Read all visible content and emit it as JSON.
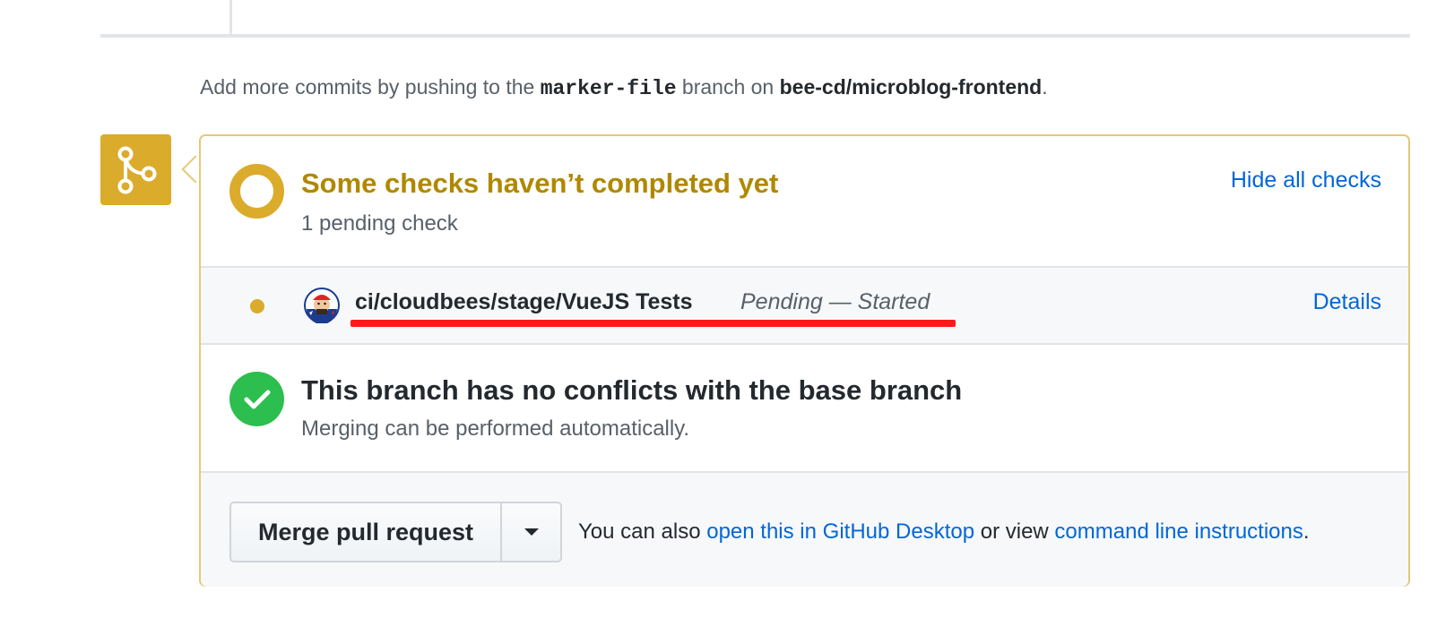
{
  "hint": {
    "prefix": "Add more commits by pushing to the ",
    "branch": "marker-file",
    "middle": " branch on ",
    "repo": "bee-cd/microblog-frontend",
    "suffix": "."
  },
  "checks": {
    "title": "Some checks haven’t completed yet",
    "subtitle": "1 pending check",
    "hide_label": "Hide all checks",
    "items": [
      {
        "name": "ci/cloudbees/stage/VueJS Tests",
        "status": "Pending — Started",
        "details_label": "Details",
        "status_icon": "pending-dot-icon",
        "avatar_icon": "jenkins-avatar-icon"
      }
    ]
  },
  "conflicts": {
    "title": "This branch has no conflicts with the base branch",
    "subtitle": "Merging can be performed automatically."
  },
  "merge": {
    "button_label": "Merge pull request",
    "help_prefix": "You can also ",
    "desktop_link": "open this in GitHub Desktop",
    "help_middle": " or view ",
    "cli_link": "command line instructions",
    "help_suffix": "."
  },
  "colors": {
    "pending": "#dbab2c",
    "pending_text": "#b08800",
    "success": "#2cbe4e",
    "link": "#0366d6",
    "annotation": "#ff1a1a"
  }
}
